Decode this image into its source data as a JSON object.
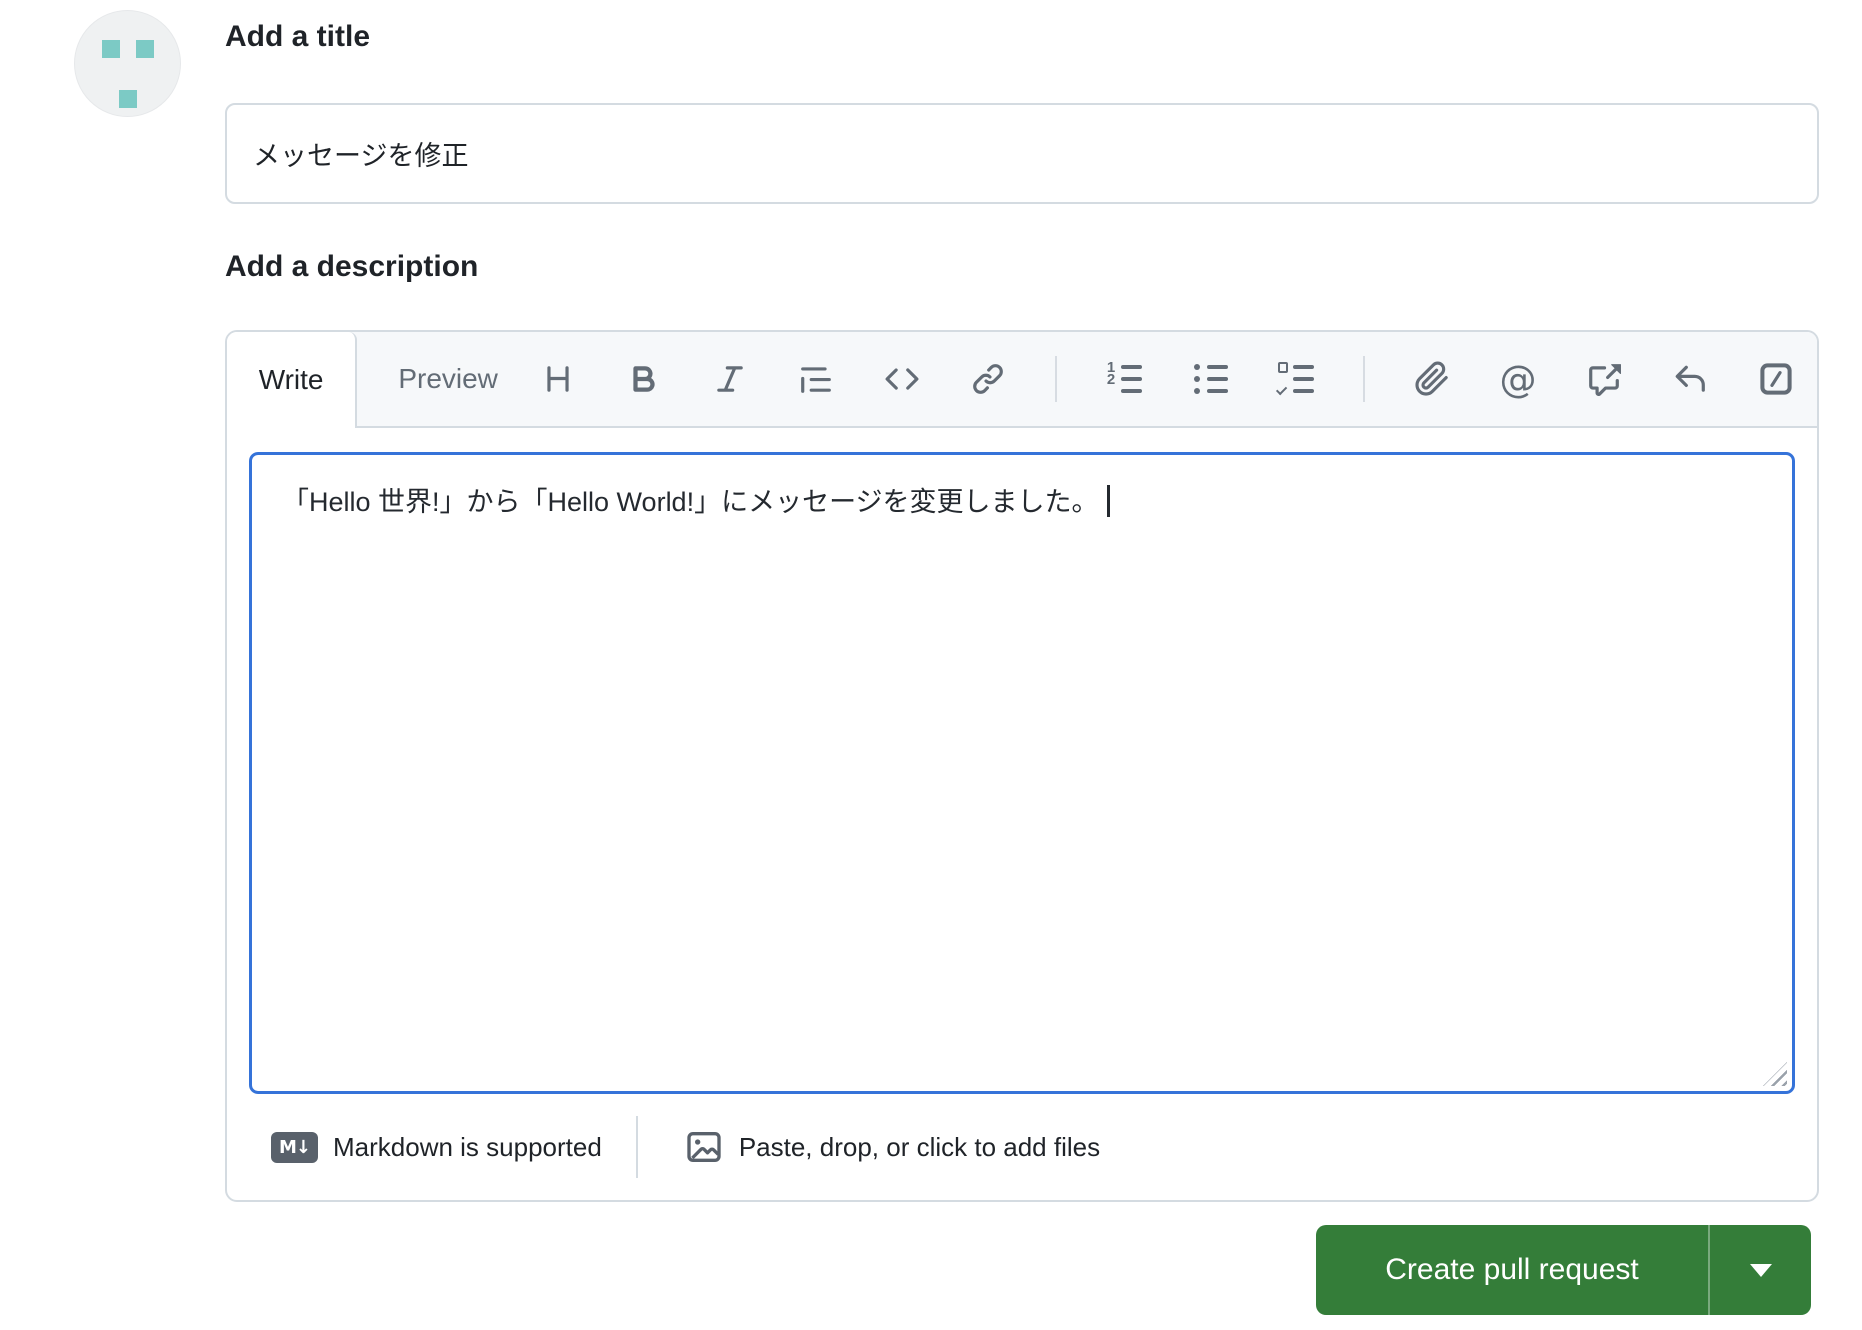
{
  "avatar": {
    "background": "#eff1f2",
    "squares_color": "#7ccac5"
  },
  "title_section": {
    "label": "Add a title",
    "value": "メッセージを修正"
  },
  "description_section": {
    "label": "Add a description",
    "tabs": {
      "write": "Write",
      "preview": "Preview"
    },
    "toolbar_icons": [
      "heading-icon",
      "bold-icon",
      "italic-icon",
      "quote-icon",
      "code-icon",
      "link-icon",
      "numbered-list-icon",
      "bullet-list-icon",
      "task-list-icon",
      "attach-file-icon",
      "mention-icon",
      "cross-reference-icon",
      "saved-reply-icon",
      "slash-commands-icon"
    ],
    "glyphs": {
      "mention": "@",
      "markdown_badge": "M↓",
      "ordered_1": "1",
      "ordered_2": "2"
    },
    "body_value": "「Hello 世界!」から「Hello World!」にメッセージを変更しました。",
    "footer": {
      "markdown_note": "Markdown is supported",
      "attach_hint": "Paste, drop, or click to add files"
    }
  },
  "actions": {
    "create_pull_request": "Create pull request"
  },
  "colors": {
    "button_green": "#347d39",
    "focus_blue": "#3573d9",
    "border": "#d4dbe1",
    "header_bg": "#f6f8fa",
    "muted_text": "#636c76"
  }
}
